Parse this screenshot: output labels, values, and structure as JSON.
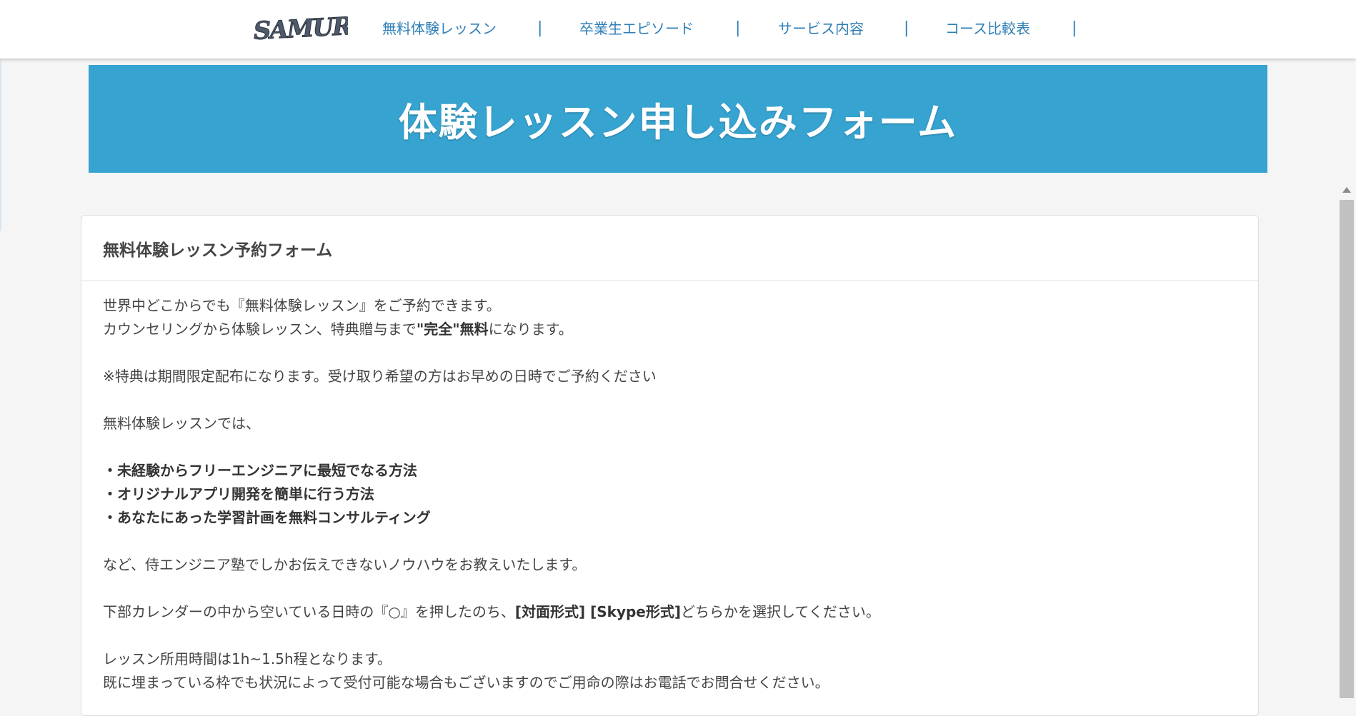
{
  "header": {
    "logo_text": "SAMURAI",
    "nav": [
      {
        "label": "無料体験レッスン"
      },
      {
        "label": "卒業生エピソード"
      },
      {
        "label": "サービス内容"
      },
      {
        "label": "コース比較表"
      }
    ],
    "separator": "|"
  },
  "banner": {
    "title": "体験レッスン申し込みフォーム"
  },
  "card": {
    "title": "無料体験レッスン予約フォーム",
    "line1": "世界中どこからでも『無料体験レッスン』をご予約できます。",
    "line2_pre": "カウンセリングから体験レッスン、特典贈与まで",
    "line2_bold": "\"完全\"無料",
    "line2_post": "になります。",
    "line3": "※特典は期間限定配布になります。受け取り希望の方はお早めの日時でご予約ください",
    "line4": "無料体験レッスンでは、",
    "bullets": [
      "・未経験からフリーエンジニアに最短でなる方法",
      "・オリジナルアプリ開発を簡単に行う方法",
      "・あなたにあった学習計画を無料コンサルティング"
    ],
    "line5": "など、侍エンジニア塾でしかお伝えできないノウハウをお教えいたします。",
    "line6_pre": "下部カレンダーの中から空いている日時の『○』を押したのち、",
    "line6_bold": "[対面形式] [Skype形式]",
    "line6_post": "どちらかを選択してください。",
    "line7": "レッスン所用時間は1h~1.5h程となります。",
    "line8": "既に埋まっている枠でも状況によって受付可能な場合もございますのでご用命の際はお電話でお問合せください。"
  },
  "colors": {
    "nav_text": "#2f7fb6",
    "banner_bg": "#36a3d0",
    "page_bg": "#f5f5f5"
  }
}
